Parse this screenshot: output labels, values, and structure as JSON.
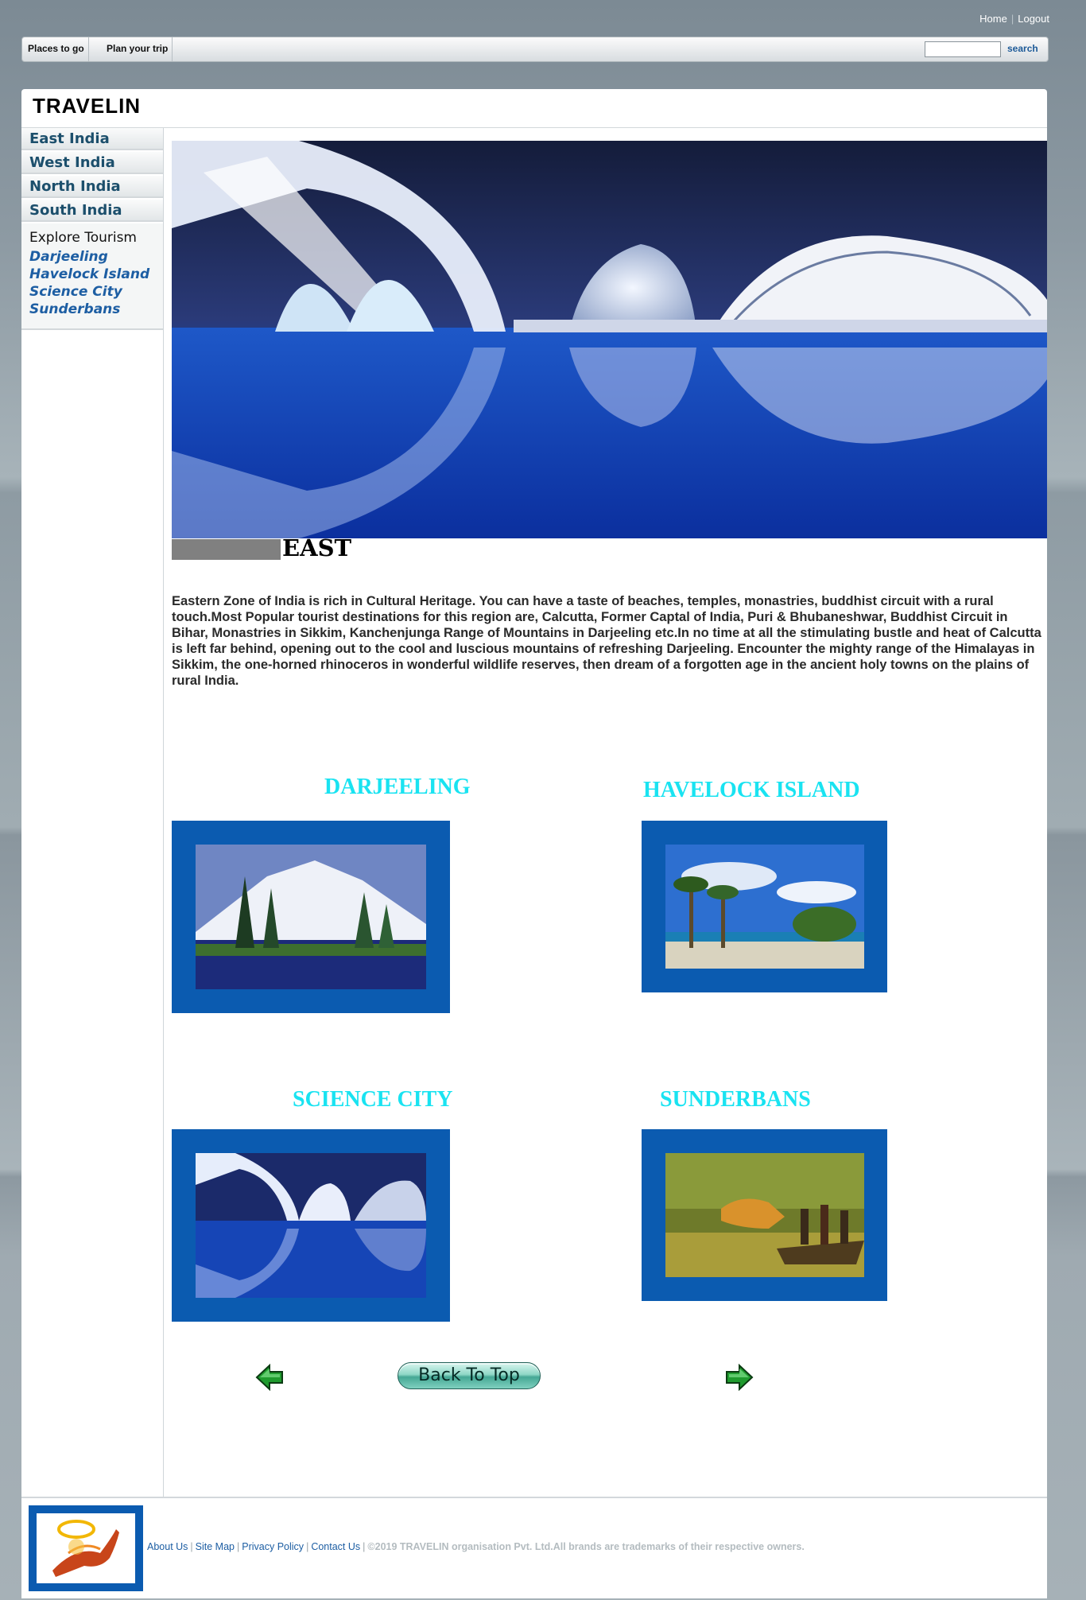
{
  "top_links": {
    "home": "Home",
    "logout": "Logout"
  },
  "nav": {
    "items": [
      "Places to go",
      "Plan your trip"
    ],
    "search_value": "",
    "search_label": "search"
  },
  "brand": "TRAVELIN",
  "sidebar": {
    "regions": [
      "East India",
      "West India",
      "North India",
      "South India"
    ],
    "explore_title": "Explore Tourism",
    "explore_links": [
      "Darjeeling",
      "Havelock Island",
      "Science City",
      "Sunderbans"
    ]
  },
  "section": {
    "title": "EAST",
    "description": "Eastern Zone of India is rich in Cultural Heritage. You can have a taste of beaches, temples, monastries, buddhist circuit with a rural touch.Most Popular tourist destinations for this region are, Calcutta, Former Captal of India, Puri & Bhubaneshwar, Buddhist Circuit in Bihar, Monastries in Sikkim, Kanchenjunga Range of Mountains in Darjeeling etc.In no time at all the stimulating bustle and heat of Calcutta is left far behind, opening out to the cool and luscious mountains of refreshing Darjeeling. Encounter the mighty range of the Himalayas in Sikkim, the one-horned rhinoceros in wonderful wildlife reserves, then dream of a forgotten age in the ancient holy towns on the plains of rural India."
  },
  "destinations": [
    {
      "title": "DARJEELING",
      "image": "mountain-lake-photo"
    },
    {
      "title": "HAVELOCK ISLAND",
      "image": "palm-beach-photo"
    },
    {
      "title": "SCIENCE CITY",
      "image": "futuristic-architecture-photo"
    },
    {
      "title": "SUNDERBANS",
      "image": "tiger-boat-photo"
    }
  ],
  "pager": {
    "back_to_top": "Back To Top",
    "prev_icon": "arrow-left-icon",
    "next_icon": "arrow-right-icon"
  },
  "footer": {
    "links": [
      "About Us",
      "Site Map",
      "Privacy Policy",
      "Contact Us"
    ],
    "copyright": "©2019 TRAVELIN organisation Pvt. Ltd.All brands are trademarks of their respective owners."
  },
  "colors": {
    "accent": "#19e3f1",
    "frame": "#0b5bb0",
    "link": "#1d5ea3"
  }
}
